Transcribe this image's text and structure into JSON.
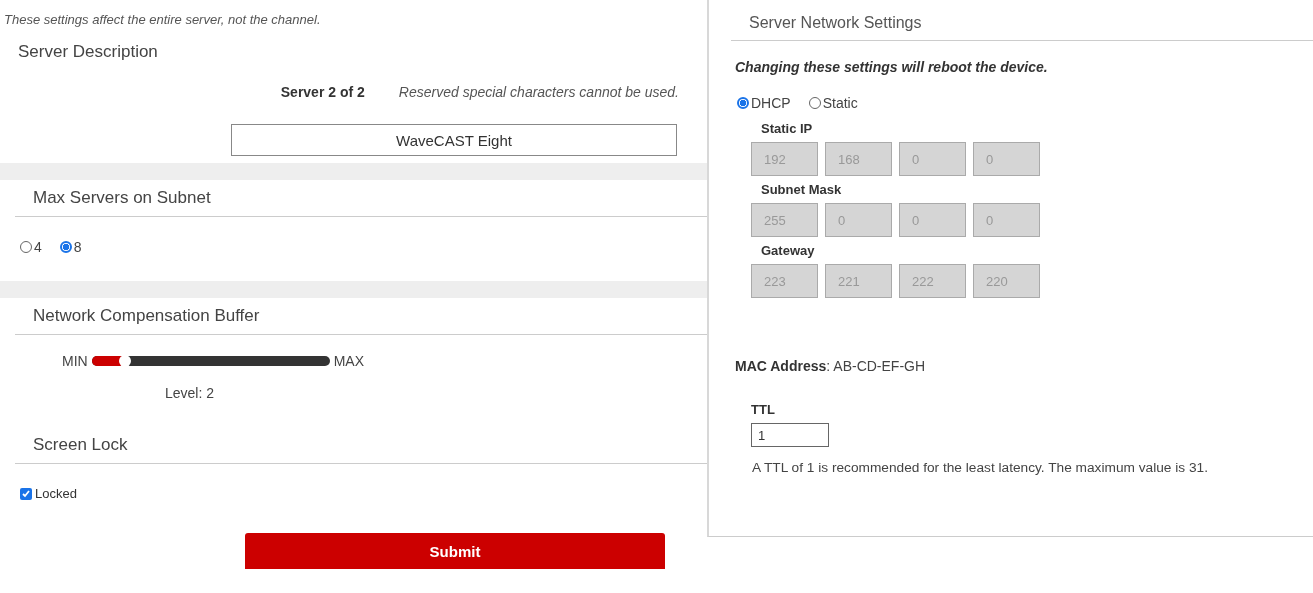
{
  "left": {
    "note": "These settings affect the entire server, not the channel.",
    "server_description": {
      "title": "Server Description",
      "server_label": "Server 2 of 2",
      "hint": "Reserved special characters cannot be used.",
      "value": "WaveCAST Eight"
    },
    "max_servers": {
      "title": "Max Servers on Subnet",
      "options": [
        {
          "label": "4",
          "selected": false
        },
        {
          "label": "8",
          "selected": true
        }
      ]
    },
    "buffer": {
      "title": "Network Compensation Buffer",
      "min_label": "MIN",
      "max_label": "MAX",
      "level": 0.14,
      "reading": "Level: 2"
    },
    "screen_lock": {
      "title": "Screen Lock",
      "label": "Locked",
      "checked": true
    },
    "submit": "Submit"
  },
  "right": {
    "title": "Server Network Settings",
    "warning": "Changing these settings will reboot the device.",
    "modes": [
      {
        "label": "DHCP",
        "selected": true
      },
      {
        "label": "Static",
        "selected": false
      }
    ],
    "groups": [
      {
        "label": "Static IP",
        "octets": [
          "192",
          "168",
          "0",
          "0"
        ],
        "disabled": true
      },
      {
        "label": "Subnet Mask",
        "octets": [
          "255",
          "0",
          "0",
          "0"
        ],
        "disabled": true
      },
      {
        "label": "Gateway",
        "octets": [
          "223",
          "221",
          "222",
          "220"
        ],
        "disabled": true
      }
    ],
    "mac": {
      "label": "MAC Address",
      "value": ": AB-CD-EF-GH"
    },
    "ttl": {
      "label": "TTL",
      "value": "1",
      "help": "A TTL of 1 is recommended for the least latency. The maximum value is 31."
    }
  }
}
